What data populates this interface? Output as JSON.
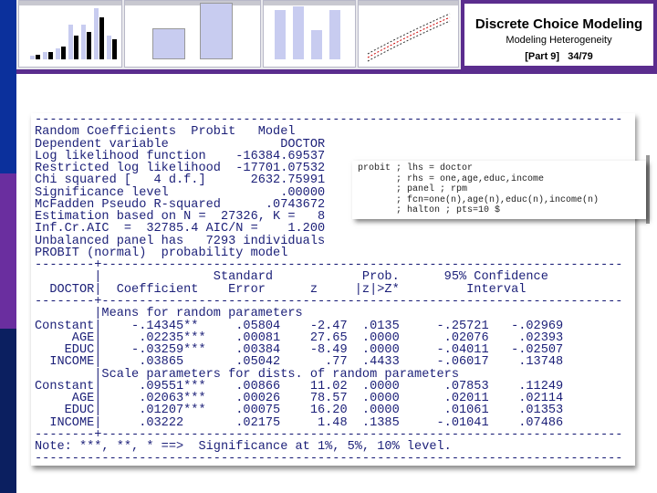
{
  "header": {
    "title": "Discrete Choice Modeling",
    "subtitle": "Modeling Heterogeneity",
    "part": "[Part 9]",
    "page": "34/79"
  },
  "colors": {
    "blue": "#0b309c",
    "purple": "#5b2d8e",
    "navy": "#0b1f60",
    "text": "#1b1f78"
  },
  "command": {
    "lines": [
      "probit ; lhs = doctor",
      "       ; rhs = one,age,educ,income",
      "       ; panel ; rpm",
      "       ; fcn=one(n),age(n),educ(n),income(n)",
      "       ; halton ; pts=10 $"
    ]
  },
  "output": {
    "lines": [
      "-------------------------------------------------------------------------------",
      "Random Coefficients  Probit   Model",
      "Dependent variable               DOCTOR",
      "Log likelihood function    -16384.69537",
      "Restricted log likelihood  -17701.07532",
      "Chi squared [   4 d.f.]      2632.75991",
      "Significance level               .00000",
      "McFadden Pseudo R-squared      .0743672",
      "Estimation based on N =  27326, K =   8",
      "Inf.Cr.AIC  =  32785.4 AIC/N =    1.200",
      "Unbalanced panel has   7293 individuals",
      "PROBIT (normal)  probability model",
      "--------+----------------------------------------------------------------------",
      "        |               Standard            Prob.      95% Confidence",
      "  DOCTOR|  Coefficient    Error      z     |z|>Z*         Interval",
      "--------+----------------------------------------------------------------------",
      "        |Means for random parameters",
      "Constant|    -.14345**     .05804    -2.47  .0135     -.25721   -.02969",
      "     AGE|     .02235***    .00081    27.65  .0000      .02076    .02393",
      "    EDUC|    -.03259***    .00384    -8.49  .0000     -.04011   -.02507",
      "  INCOME|     .03865       .05042      .77  .4433     -.06017    .13748",
      "        |Scale parameters for dists. of random parameters",
      "Constant|     .09551***    .00866    11.02  .0000      .07853    .11249",
      "     AGE|     .02063***    .00026    78.57  .0000      .02011    .02114",
      "    EDUC|     .01207***    .00075    16.20  .0000      .01061    .01353",
      "  INCOME|     .03222       .02175     1.48  .1385     -.01041    .07486",
      "--------+----------------------------------------------------------------------",
      "Note: ***, **, * ==>  Significance at 1%, 5%, 10% level.",
      "-------------------------------------------------------------------------------"
    ]
  }
}
